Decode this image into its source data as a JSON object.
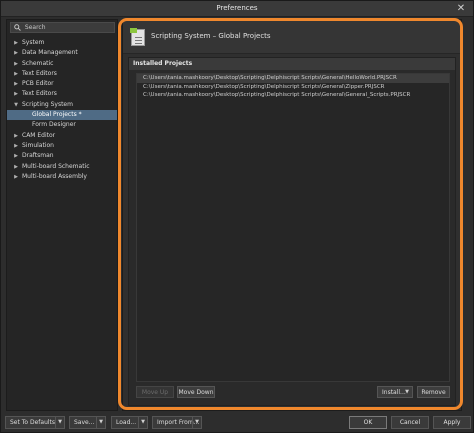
{
  "window": {
    "title": "Preferences",
    "close_glyph": "✕"
  },
  "search": {
    "placeholder": "Search",
    "icon": "search-icon"
  },
  "tree": [
    {
      "label": "System",
      "expanded": false,
      "child": false
    },
    {
      "label": "Data Management",
      "expanded": false,
      "child": false
    },
    {
      "label": "Schematic",
      "expanded": false,
      "child": false
    },
    {
      "label": "Text Editors",
      "expanded": false,
      "child": false
    },
    {
      "label": "PCB Editor",
      "expanded": false,
      "child": false
    },
    {
      "label": "Text Editors",
      "expanded": false,
      "child": false
    },
    {
      "label": "Scripting System",
      "expanded": true,
      "child": false
    },
    {
      "label": "Global Projects *",
      "child": true,
      "selected": true
    },
    {
      "label": "Form Designer",
      "child": true
    },
    {
      "label": "CAM Editor",
      "expanded": false,
      "child": false
    },
    {
      "label": "Simulation",
      "expanded": false,
      "child": false
    },
    {
      "label": "Draftsman",
      "expanded": false,
      "child": false
    },
    {
      "label": "Multi-board Schematic",
      "expanded": false,
      "child": false
    },
    {
      "label": "Multi-board Assembly",
      "expanded": false,
      "child": false
    }
  ],
  "header": {
    "title": "Scripting System – Global Projects",
    "icon": "document-icon"
  },
  "installed": {
    "title": "Installed Projects",
    "items": [
      "C:\\Users\\tania.mashkoory\\Desktop\\Scripting\\Delphiscript Scripts\\General\\HelloWorld.PRJSCR",
      "C:\\Users\\tania.mashkoory\\Desktop\\Scripting\\Delphiscript Scripts\\General\\Zipper.PRJSCR",
      "C:\\Users\\tania.mashkoory\\Desktop\\Scripting\\Delphiscript Scripts\\General\\General_Scripts.PRJSCR"
    ]
  },
  "buttons": {
    "move_up": "Move Up",
    "move_down": "Move Down",
    "install": "Install...",
    "remove": "Remove"
  },
  "bottom": {
    "set_to_defaults": "Set To Defaults",
    "save": "Save...",
    "load": "Load...",
    "import_from": "Import From...",
    "ok": "OK",
    "cancel": "Cancel",
    "apply": "Apply"
  },
  "colors": {
    "highlight": "#f0882d",
    "selection": "#4f6b85",
    "accent_icon": "#8cc63f"
  }
}
